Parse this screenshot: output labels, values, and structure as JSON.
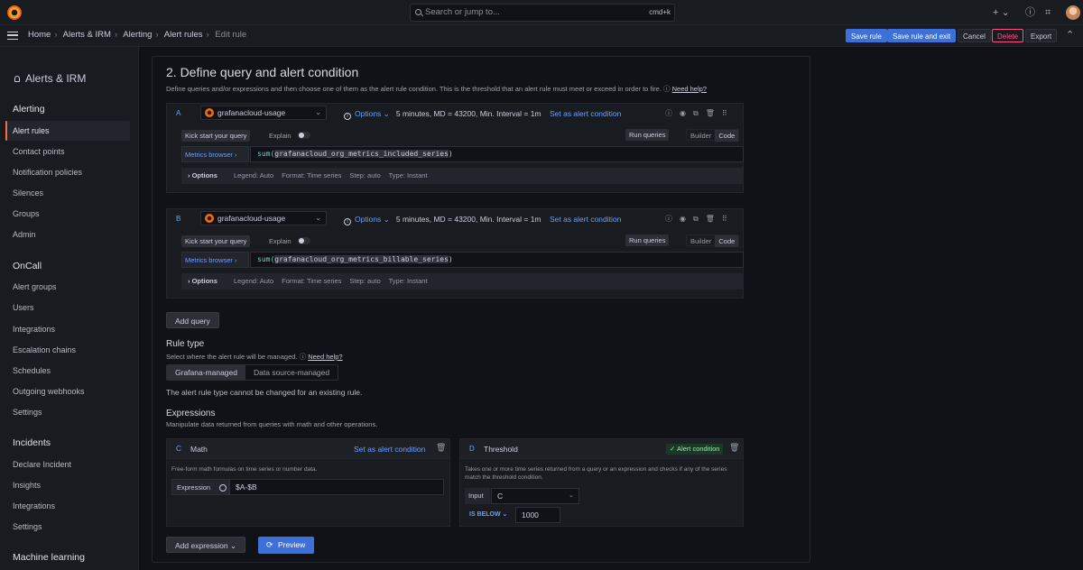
{
  "topbar": {
    "search_placeholder": "Search or jump to...",
    "search_shortcut": "cmd+k",
    "icons": [
      "grafana-logo-icon",
      "search-icon",
      "plus-icon",
      "help-icon",
      "rss-icon",
      "avatar"
    ]
  },
  "navbar": {
    "breadcrumbs": [
      "Home",
      "Alerts & IRM",
      "Alerting",
      "Alert rules",
      "Edit rule"
    ],
    "save_label": "Save rule",
    "save_exit_label": "Save rule and exit",
    "cancel_label": "Cancel",
    "delete_label": "Delete",
    "export_label": "Export"
  },
  "sidebar": {
    "title": "Alerts & IRM",
    "sections": [
      {
        "label": "Alerting",
        "items": [
          "Alert rules",
          "Contact points",
          "Notification policies",
          "Silences",
          "Groups",
          "Admin"
        ]
      },
      {
        "label": "OnCall",
        "items": [
          "Alert groups",
          "Users",
          "Integrations",
          "Escalation chains",
          "Schedules",
          "Outgoing webhooks",
          "Settings"
        ]
      },
      {
        "label": "Incidents",
        "items": [
          "Declare Incident",
          "Insights",
          "Integrations",
          "Settings"
        ]
      },
      {
        "label": "Machine learning",
        "items": []
      }
    ],
    "active_item": "Alert rules"
  },
  "section": {
    "title": "2. Define query and alert condition",
    "description": "Define queries and/or expressions and then choose one of them as the alert rule condition. This is the threshold that an alert rule must meet or exceed in order to fire.",
    "help_link": "Need help?"
  },
  "queries": [
    {
      "ref": "A",
      "datasource": "grafanacloud-usage",
      "options_label": "Options",
      "options_summary": "5 minutes, MD = 43200, Min. Interval = 1m",
      "set_condition": "Set as alert condition",
      "kick_start": "Kick start your query",
      "explain": "Explain",
      "run_queries": "Run queries",
      "builder": "Builder",
      "code": "Code",
      "metrics_browser": "Metrics browser ›",
      "expr_fn": "sum(",
      "expr_metric": "grafanacloud_org_metrics_included_series",
      "expr_close": ")",
      "opt_label": "Options",
      "legend": "Legend: Auto",
      "format": "Format: Time series",
      "step": "Step: auto",
      "type": "Type: Instant"
    },
    {
      "ref": "B",
      "datasource": "grafanacloud-usage",
      "options_label": "Options",
      "options_summary": "5 minutes, MD = 43200, Min. Interval = 1m",
      "set_condition": "Set as alert condition",
      "kick_start": "Kick start your query",
      "explain": "Explain",
      "run_queries": "Run queries",
      "builder": "Builder",
      "code": "Code",
      "metrics_browser": "Metrics browser ›",
      "expr_fn": "sum(",
      "expr_metric": "grafanacloud_org_metrics_billable_series",
      "expr_close": ")",
      "opt_label": "Options",
      "legend": "Legend: Auto",
      "format": "Format: Time series",
      "step": "Step: auto",
      "type": "Type: Instant"
    }
  ],
  "add_query_label": "Add query",
  "rule_type": {
    "title": "Rule type",
    "description": "Select where the alert rule will be managed.",
    "help_link": "Need help?",
    "options": [
      "Grafana-managed",
      "Data source-managed"
    ],
    "selected": "Grafana-managed",
    "note": "The alert rule type cannot be changed for an existing rule."
  },
  "expressions": {
    "title": "Expressions",
    "description": "Manipulate data returned from queries with math and other operations.",
    "math": {
      "ref": "C",
      "title": "Math",
      "set_condition": "Set as alert condition",
      "description": "Free-form math formulas on time series or number data.",
      "expression_label": "Expression",
      "expression_value": "$A-$B"
    },
    "threshold": {
      "ref": "D",
      "title": "Threshold",
      "badge": "✓ Alert condition",
      "description": "Takes one or more time series returned from a query or an expression and checks if any of the series match the threshold condition.",
      "input_label": "Input",
      "input_value": "C",
      "operator": "IS BELOW ⌄",
      "value": "1000"
    }
  },
  "add_expression_label": "Add expression ⌄",
  "preview_label": "Preview"
}
